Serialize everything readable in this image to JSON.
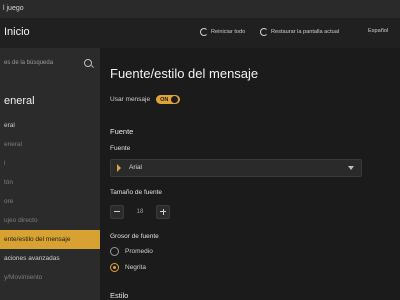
{
  "window": {
    "title": "l juego"
  },
  "topbar": {
    "home_label": "Inicio",
    "reset_all": "Reiniciar todo",
    "reset_screen": "Restaurar la pantalla actual",
    "language": "Español"
  },
  "sidebar": {
    "search_placeholder": "es de la búsqueda",
    "section_title": "eneral",
    "items": [
      {
        "label": "eral",
        "dim": false
      },
      {
        "label": "eneral",
        "dim": true
      },
      {
        "label": "l",
        "dim": true
      },
      {
        "label": "tón",
        "dim": true
      },
      {
        "label": "ore",
        "dim": true
      },
      {
        "label": "ujeo directo",
        "dim": true
      },
      {
        "label": "ente/estilo del mensaje",
        "active": true
      },
      {
        "label": "aciones avanzadas",
        "dim": false
      },
      {
        "label": "y/Movimiento",
        "dim": true
      }
    ]
  },
  "main": {
    "title": "Fuente/estilo del mensaje",
    "use_message_label": "Usar mensaje",
    "use_message_state": "ON",
    "section_font": "Fuente",
    "font_label": "Fuente",
    "font_value": "Arial",
    "size_label": "Tamaño de fuente",
    "size_value": "18",
    "weight_label": "Grosor de fuente",
    "weight_options": [
      "Promedio",
      "Negrita"
    ],
    "weight_selected": "Negrita",
    "section_style": "Estilo"
  },
  "colors": {
    "accent": "#e1a23a",
    "active_nav": "#d7a232",
    "background": "#1b1b1b",
    "sidebar": "#2b2b2b"
  }
}
